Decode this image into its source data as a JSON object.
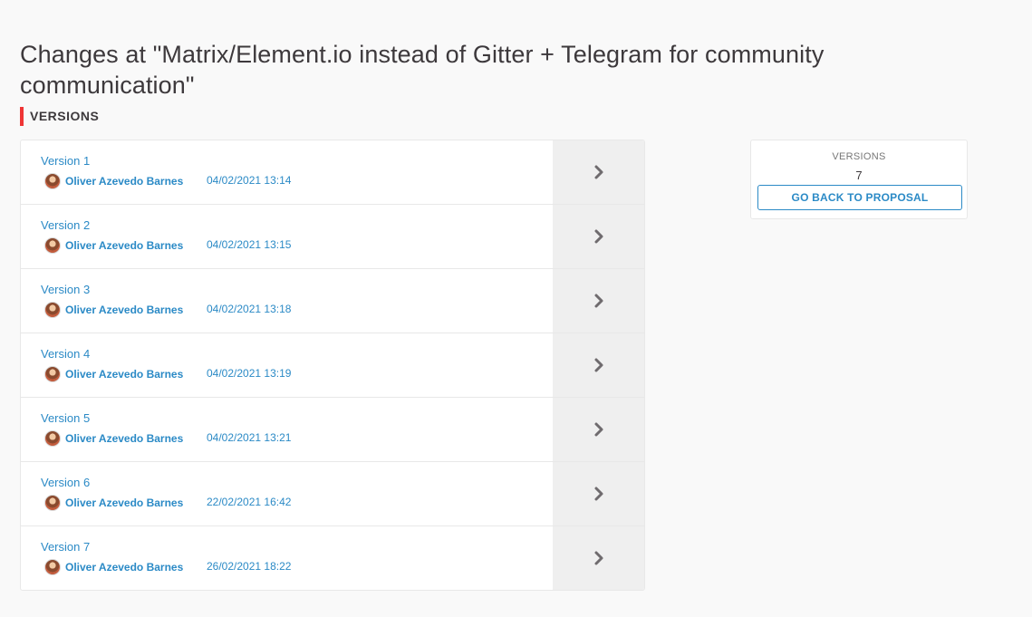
{
  "page": {
    "title": "Changes at \"Matrix/Element.io instead of Gitter + Telegram for community communication\"",
    "section_heading": "VERSIONS"
  },
  "versions": [
    {
      "label": "Version 1",
      "author": "Oliver Azevedo Barnes",
      "date": "04/02/2021 13:14"
    },
    {
      "label": "Version 2",
      "author": "Oliver Azevedo Barnes",
      "date": "04/02/2021 13:15"
    },
    {
      "label": "Version 3",
      "author": "Oliver Azevedo Barnes",
      "date": "04/02/2021 13:18"
    },
    {
      "label": "Version 4",
      "author": "Oliver Azevedo Barnes",
      "date": "04/02/2021 13:19"
    },
    {
      "label": "Version 5",
      "author": "Oliver Azevedo Barnes",
      "date": "04/02/2021 13:21"
    },
    {
      "label": "Version 6",
      "author": "Oliver Azevedo Barnes",
      "date": "22/02/2021 16:42"
    },
    {
      "label": "Version 7",
      "author": "Oliver Azevedo Barnes",
      "date": "26/02/2021 18:22"
    }
  ],
  "sidebar": {
    "versions_label": "VERSIONS",
    "versions_count": "7",
    "back_button_label": "GO BACK TO PROPOSAL"
  },
  "icons": {
    "row_arrow": "chevron-right-icon",
    "author_avatar": "avatar"
  },
  "colors": {
    "accent_link": "#2b8ac6",
    "section_marker": "#ef3535",
    "arrow": "#6f6b6e"
  }
}
